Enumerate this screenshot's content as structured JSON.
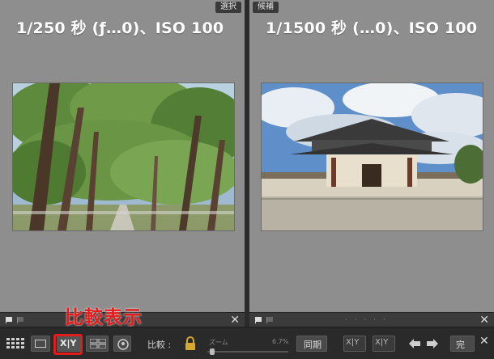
{
  "left_pane": {
    "tag": "選択",
    "exif": "1/250 秒 (ƒ…0)、ISO 100"
  },
  "right_pane": {
    "tag": "候補",
    "exif": "1/1500 秒 (…0)、ISO 100"
  },
  "pane_bar": {
    "close_glyph": "✕",
    "dots": "· · · · ·"
  },
  "annotation": {
    "label": "比較表示",
    "color": "#e21b1b"
  },
  "toolbar": {
    "compare_label": "比較 :",
    "zoom_label": "ズーム",
    "zoom_value": "6.7%",
    "sync_button": "同期",
    "done_button": "完",
    "xy_label": "X|Y"
  }
}
